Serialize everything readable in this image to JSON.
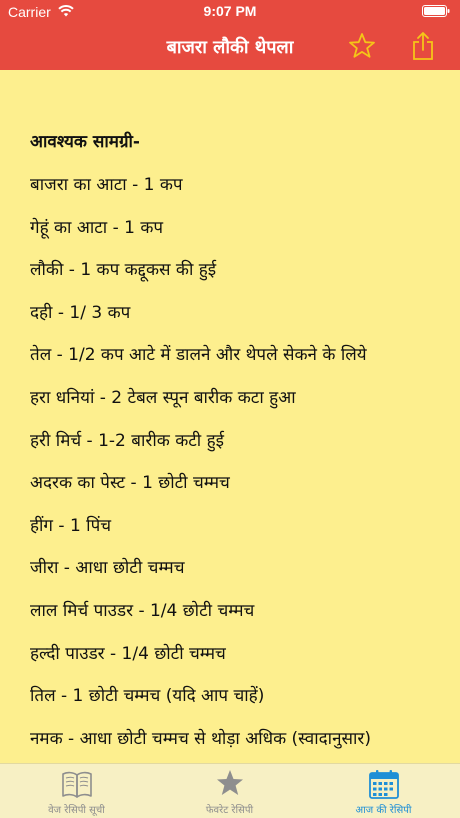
{
  "status_bar": {
    "carrier": "Carrier",
    "time": "9:07 PM"
  },
  "nav": {
    "title": "बाजरा लौकी थेपला",
    "favorite_icon": "star-outline-icon",
    "share_icon": "share-icon"
  },
  "content": {
    "heading": "आवश्यक सामग्री-",
    "ingredients": [
      "बाजरा का आटा - 1 कप",
      "गेहूं का आटा - 1 कप",
      "लौकी - 1 कप कद्दूकस की हुई",
      "दही - 1/ 3 कप",
      "तेल - 1/2 कप आटे में डालने और थेपले सेकने के लिये",
      "हरा धनियां - 2 टेबल स्पून बारीक कटा हुआ",
      "हरी मिर्च - 1-2 बारीक कटी हुई",
      "अदरक का पेस्ट - 1 छोटी चम्मच",
      "हींग - 1 पिंच",
      "जीरा - आधा छोटी चम्मच",
      "लाल मिर्च पाउडर - 1/4 छोटी चम्मच",
      "हल्दी पाउडर - 1/4 छोटी चम्मच",
      "तिल - 1 छोटी चम्मच (यदि आप चाहें)",
      "नमक - आधा छोटी चम्मच से थोड़ा अधिक (स्वादानुसार)"
    ]
  },
  "tabs": [
    {
      "label": "वेज रेसिपी सूची",
      "icon": "book-icon",
      "active": false
    },
    {
      "label": "फेवरेट रेसिपी",
      "icon": "star-icon",
      "active": false
    },
    {
      "label": "आज की रेसिपी",
      "icon": "calendar-icon",
      "active": true
    }
  ],
  "colors": {
    "nav_background": "#e64a3f",
    "content_background": "#fdef8e",
    "star_accent": "#f5c518",
    "tab_active": "#1f8fd6",
    "tab_inactive": "#8e8e8e"
  }
}
